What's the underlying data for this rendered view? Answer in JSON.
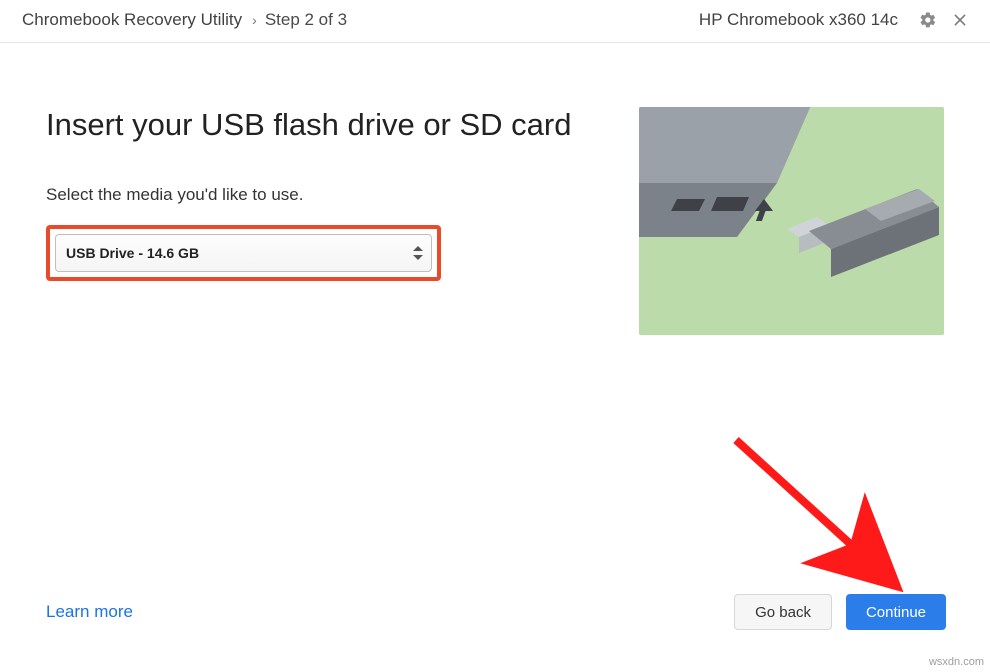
{
  "header": {
    "title": "Chromebook Recovery Utility",
    "separator": "›",
    "step": "Step 2 of 3",
    "device": "HP Chromebook x360 14c"
  },
  "main": {
    "title": "Insert your USB flash drive or SD card",
    "instruction": "Select the media you'd like to use.",
    "selected_media": "USB Drive - 14.6 GB"
  },
  "footer": {
    "learn_more": "Learn more",
    "go_back": "Go back",
    "continue": "Continue"
  },
  "watermark": "wsxdn.com"
}
